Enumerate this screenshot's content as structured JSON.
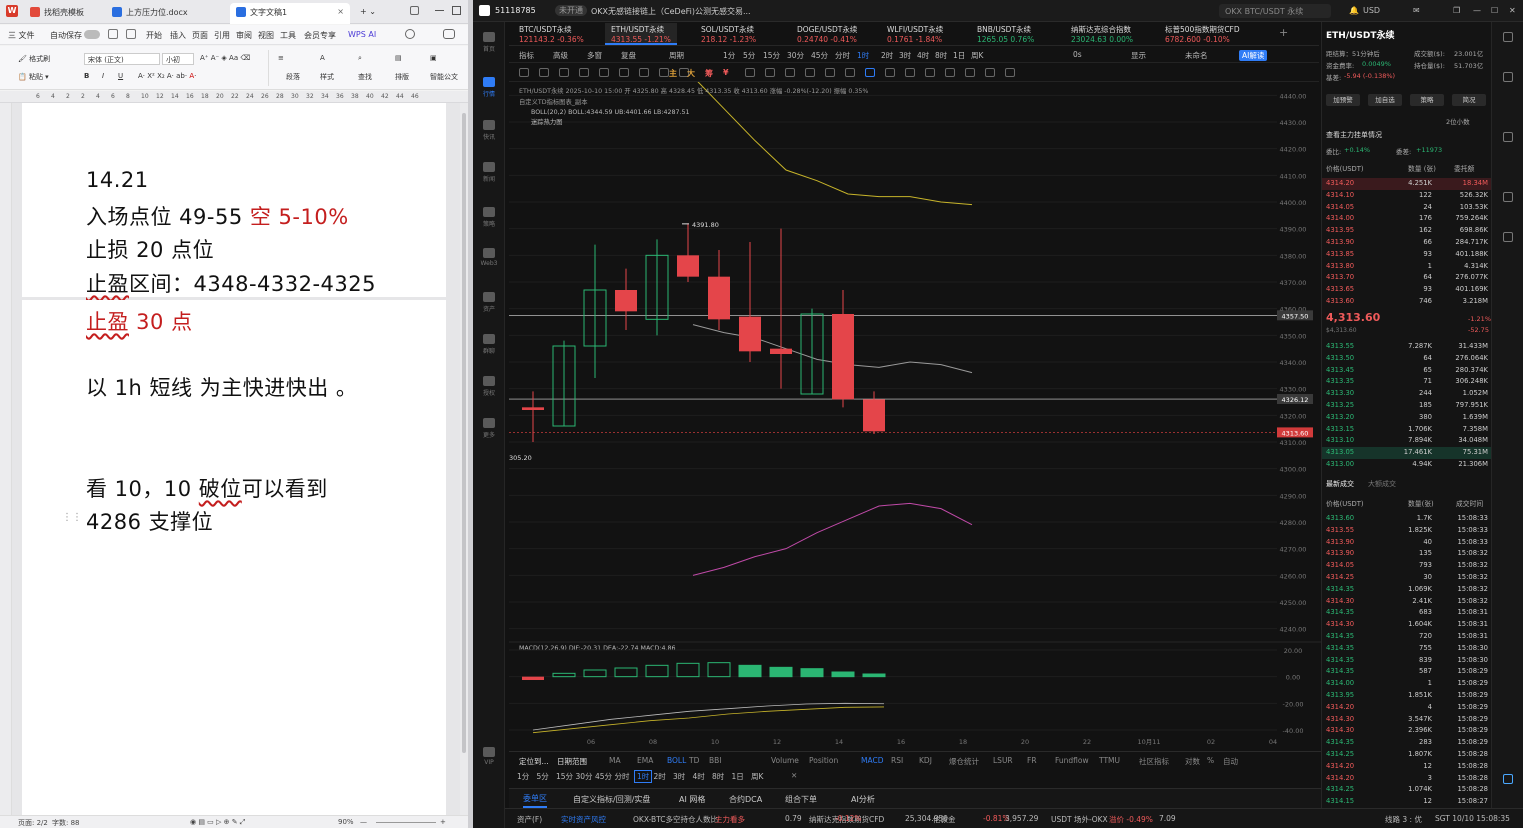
{
  "wps": {
    "tabs": [
      "找稻壳模板",
      "上方压力位.docx",
      "文字文稿1"
    ],
    "menu": [
      "三 文件",
      "自动保存",
      "开始",
      "插入",
      "页面",
      "引用",
      "审阅",
      "视图",
      "工具",
      "会员专享",
      "WPS AI"
    ],
    "tool": {
      "format_painter": "格式刷",
      "paste": "粘贴",
      "font": "宋体 (正文)",
      "size": "小初",
      "bold": "B",
      "italic": "I",
      "underline": "U",
      "paragraph": "段落",
      "style": "样式",
      "find": "查找",
      "layout": "排版",
      "smart": "智能公文"
    },
    "ruler": [
      "6",
      "4",
      "2",
      "2",
      "4",
      "6",
      "8",
      "10",
      "12",
      "14",
      "16",
      "18",
      "20",
      "22",
      "24",
      "26",
      "28",
      "30",
      "32",
      "34",
      "36",
      "38",
      "40",
      "42",
      "44",
      "46"
    ],
    "doc": {
      "l1": "14.21",
      "l2a": "入场点位 49-55 ",
      "l2b": "空  5-10%",
      "l3": "止损 20 点位",
      "l4a": "止盈",
      "l4b": "区间：4348-4332-4325",
      "l5a": "止盈",
      "l5b": " 30 点",
      "l6": "以 1h 短线  为主快进快出  。",
      "l7a": "看 10，10 ",
      "l7b": "破位",
      "l7c": "可以看到",
      "l8": "4286 支撑位"
    },
    "status": {
      "page": "页面: 2/2",
      "words": "字数: 88",
      "zoom": "90%"
    }
  },
  "okx": {
    "account": "51118785",
    "badge": "未开通",
    "notice": "OKX无感链接链上（CeDeFi)公测无感交易...",
    "search": "OKX BTC/USDT 永续",
    "currency": "USD",
    "tickers": [
      {
        "name": "BTC/USDT永续",
        "price": "121143.2",
        "chg": "-0.36%",
        "up": false
      },
      {
        "name": "ETH/USDT永续",
        "price": "4313.55",
        "chg": "-1.21%",
        "up": false
      },
      {
        "name": "SOL/USDT永续",
        "price": "218.12",
        "chg": "-1.23%",
        "up": false
      },
      {
        "name": "DOGE/USDT永续",
        "price": "0.24740",
        "chg": "-0.41%",
        "up": false
      },
      {
        "name": "WLFI/USDT永续",
        "price": "0.1761",
        "chg": "-1.84%",
        "up": false
      },
      {
        "name": "BNB/USDT永续",
        "price": "1265.05",
        "chg": "0.76%",
        "up": true
      },
      {
        "name": "纳斯达克综合指数",
        "price": "23024.63",
        "chg": "0.00%",
        "up": true
      },
      {
        "name": "标普500指数期货CFD",
        "price": "6782.600",
        "chg": "-0.10%",
        "up": false
      }
    ],
    "chart_tools": [
      "指标",
      "高级",
      "多窗",
      "复盘",
      "周期",
      "1分",
      "5分",
      "15分",
      "30分",
      "45分",
      "分时",
      "1时",
      "2时",
      "3时",
      "4时",
      "8时",
      "1日",
      "周K",
      "0s",
      "显示",
      "未命名",
      "AI解读"
    ],
    "draw_tools": [
      "主",
      "大",
      "筹",
      "¥"
    ],
    "legend": {
      "line1": "ETH/USDT永续 2025-10-10 15:00 开 4325.80 高 4328.45 低 4313.35 收 4313.60 涨幅 -0.28%(-12.20) 振幅 0.35%",
      "line2": "自定义TD指标图表_副本",
      "line3": "BOLL(20,2) BOLL:4344.59 UB:4401.66 LB:4287.51",
      "line4": "迷踪热力图",
      "macd": "MACD(12,26,9) DIF:-20.31 DEA:-22.74 MACD:4.86"
    },
    "high_label": "4391.80",
    "low_label": "305.20",
    "price_tags": [
      "4357.50",
      "4326.12",
      "4313.60"
    ],
    "y_ticks": [
      "4440.00",
      "4430.00",
      "4420.00",
      "4410.00",
      "4400.00",
      "4390.00",
      "4380.00",
      "4370.00",
      "4360.00",
      "4350.00",
      "4340.00",
      "4330.00",
      "4320.00",
      "4310.00",
      "4300.00",
      "4290.00",
      "4280.00",
      "4270.00",
      "4260.00",
      "4250.00",
      "4240.00"
    ],
    "macd_ticks": [
      "20.00",
      "0.00",
      "-20.00",
      "-40.00"
    ],
    "x_ticks": [
      "06",
      "08",
      "10",
      "12",
      "14",
      "16",
      "18",
      "20",
      "22",
      "10月11",
      "02",
      "04"
    ],
    "indicator_tabs": [
      "定位到...",
      "日期范围",
      "MA",
      "EMA",
      "BOLL",
      "TD",
      "BBI",
      "Volume",
      "Position",
      "MACD",
      "RSI",
      "KDJ",
      "爆仓统计",
      "LSUR",
      "FR",
      "Fundflow",
      "TTMU",
      "社区指标",
      "对数",
      "%",
      "自动"
    ],
    "bottom_tfs": [
      "1分",
      "5分",
      "15分",
      "30分",
      "45分",
      "分时",
      "1时",
      "2时",
      "3时",
      "4时",
      "8时",
      "1日",
      "周K"
    ],
    "bottom_panels": [
      "委单区",
      "自定义指标/回测/实盘",
      "AI 网格",
      "合约DCA",
      "组合下单",
      "AI分析"
    ],
    "status": [
      "资产(F)",
      "实时资产风控",
      "OKX-BTC多空持仓人数比",
      "主力看多",
      "0.79",
      "纳斯达克指数期货CFD",
      "-0.12%",
      "25,304.950",
      "伦敦金",
      "-0.81%",
      "3,957.29",
      "USDT 场外-OKX",
      "溢价 -0.49%",
      "7.09",
      "线路 3 : 优",
      "SGT 10/10 15:08:35"
    ],
    "sidebar": [
      "首页",
      "行情",
      "快讯",
      "新闻",
      "策略",
      "Web3",
      "资产",
      "群聊",
      "授权",
      "更多",
      "VIP"
    ],
    "book": {
      "title": "ETH/USDT永续",
      "next_fund": "距结算：51分钟后",
      "rate": "资金费率:",
      "rate_v": "0.0049%",
      "basis": "基差:",
      "basis_v": "-5.94 (-0.138%)",
      "vol_l": "成交额($):",
      "vol_v": "23.001亿",
      "oi_l": "持仓量($):",
      "oi_v": "51.703亿",
      "btns": [
        "加预警",
        "加自选",
        "策略",
        "简况"
      ],
      "decimals": "2位小数",
      "main_orders": "查看主力挂单情况",
      "ratio_l": "委比:",
      "ratio_v": "+0.14%",
      "diff_l": "委差:",
      "diff_v": "+11973",
      "hdr": [
        "价格(USDT)",
        "数量 (张)",
        "委托额"
      ],
      "asks": [
        [
          "4314.20",
          "4.251K",
          "18.34M"
        ],
        [
          "4314.10",
          "122",
          "526.32K"
        ],
        [
          "4314.05",
          "24",
          "103.53K"
        ],
        [
          "4314.00",
          "176",
          "759.264K"
        ],
        [
          "4313.95",
          "162",
          "698.86K"
        ],
        [
          "4313.90",
          "66",
          "284.717K"
        ],
        [
          "4313.85",
          "93",
          "401.188K"
        ],
        [
          "4313.80",
          "1",
          "4.314K"
        ],
        [
          "4313.70",
          "64",
          "276.077K"
        ],
        [
          "4313.65",
          "93",
          "401.169K"
        ],
        [
          "4313.60",
          "746",
          "3.218M"
        ]
      ],
      "last": "4,313.60",
      "last_sub": "$4,313.60",
      "last_chg": "-1.21%",
      "last_chg2": "-52.75",
      "bids": [
        [
          "4313.55",
          "7.287K",
          "31.433M"
        ],
        [
          "4313.50",
          "64",
          "276.064K"
        ],
        [
          "4313.45",
          "65",
          "280.374K"
        ],
        [
          "4313.35",
          "71",
          "306.248K"
        ],
        [
          "4313.30",
          "244",
          "1.052M"
        ],
        [
          "4313.25",
          "185",
          "797.951K"
        ],
        [
          "4313.20",
          "380",
          "1.639M"
        ],
        [
          "4313.15",
          "1.706K",
          "7.358M"
        ],
        [
          "4313.10",
          "7.894K",
          "34.048M"
        ],
        [
          "4313.05",
          "17.461K",
          "75.31M"
        ],
        [
          "4313.00",
          "4.94K",
          "21.306M"
        ]
      ],
      "trades_tab": "最新成交",
      "trades_tab2": "大额成交",
      "trades_hdr": [
        "价格(USDT)",
        "数量(张)",
        "成交时间"
      ],
      "trades": [
        [
          "4313.60",
          "1.7K",
          "15:08:33",
          "g"
        ],
        [
          "4313.55",
          "1.825K",
          "15:08:33",
          "r"
        ],
        [
          "4313.90",
          "40",
          "15:08:33",
          "r"
        ],
        [
          "4313.90",
          "135",
          "15:08:32",
          "r"
        ],
        [
          "4314.05",
          "793",
          "15:08:32",
          "r"
        ],
        [
          "4314.25",
          "30",
          "15:08:32",
          "r"
        ],
        [
          "4314.35",
          "1.069K",
          "15:08:32",
          "g"
        ],
        [
          "4314.30",
          "2.41K",
          "15:08:32",
          "r"
        ],
        [
          "4314.35",
          "683",
          "15:08:31",
          "g"
        ],
        [
          "4314.30",
          "1.604K",
          "15:08:31",
          "r"
        ],
        [
          "4314.35",
          "720",
          "15:08:31",
          "g"
        ],
        [
          "4314.35",
          "755",
          "15:08:30",
          "g"
        ],
        [
          "4314.35",
          "839",
          "15:08:30",
          "g"
        ],
        [
          "4314.35",
          "587",
          "15:08:29",
          "g"
        ],
        [
          "4314.00",
          "1",
          "15:08:29",
          "g"
        ],
        [
          "4313.95",
          "1.851K",
          "15:08:29",
          "g"
        ],
        [
          "4314.20",
          "4",
          "15:08:29",
          "r"
        ],
        [
          "4314.30",
          "3.547K",
          "15:08:29",
          "r"
        ],
        [
          "4314.30",
          "2.396K",
          "15:08:29",
          "r"
        ],
        [
          "4314.35",
          "283",
          "15:08:29",
          "g"
        ],
        [
          "4314.25",
          "1.807K",
          "15:08:28",
          "g"
        ],
        [
          "4314.20",
          "12",
          "15:08:28",
          "r"
        ],
        [
          "4314.20",
          "3",
          "15:08:28",
          "r"
        ],
        [
          "4314.25",
          "1.074K",
          "15:08:28",
          "g"
        ],
        [
          "4314.15",
          "12",
          "15:08:27",
          "g"
        ]
      ]
    }
  },
  "chart_data": {
    "type": "candlestick",
    "interval": "1h",
    "title": "ETH/USDT永续",
    "ylim": [
      4235,
      4445
    ],
    "candles": [
      {
        "o": 4323,
        "h": 4329,
        "l": 4310,
        "c": 4322
      },
      {
        "o": 4316,
        "h": 4348,
        "l": 4316,
        "c": 4346
      },
      {
        "o": 4346,
        "h": 4384,
        "l": 4334,
        "c": 4367
      },
      {
        "o": 4367,
        "h": 4375,
        "l": 4352,
        "c": 4359
      },
      {
        "o": 4356,
        "h": 4386,
        "l": 4350,
        "c": 4380
      },
      {
        "o": 4380,
        "h": 4392,
        "l": 4370,
        "c": 4372
      },
      {
        "o": 4372,
        "h": 4382,
        "l": 4352,
        "c": 4356
      },
      {
        "o": 4357,
        "h": 4385,
        "l": 4340,
        "c": 4344
      },
      {
        "o": 4345,
        "h": 4390,
        "l": 4330,
        "c": 4343
      },
      {
        "o": 4328,
        "h": 4360,
        "l": 4328,
        "c": 4358
      },
      {
        "o": 4358,
        "h": 4367,
        "l": 4323,
        "c": 4326
      },
      {
        "o": 4326,
        "h": 4329,
        "l": 4313,
        "c": 4314
      }
    ],
    "boll_upper": [
      4447,
      4435,
      4423,
      4412,
      4408,
      4403,
      4402,
      4402,
      4400,
      4399
    ],
    "boll_mid": [
      4354,
      4351,
      4349,
      4345,
      4341,
      4339,
      4338,
      4340,
      4339,
      4336
    ],
    "boll_lower": [
      4260,
      4263,
      4267,
      4270,
      4276,
      4281,
      4286,
      4287,
      4285,
      4279
    ],
    "macd": {
      "hist": [
        -2.5,
        2.5,
        5,
        6.5,
        8.5,
        10,
        10.5,
        8.5,
        7,
        6,
        3.5,
        2
      ],
      "dif": [
        -40,
        -36,
        -32,
        -29,
        -26,
        -24,
        -22,
        -20.5,
        -20,
        -20.3
      ],
      "dea": [
        -42,
        -39,
        -36,
        -33,
        -31,
        -28,
        -26,
        -24.5,
        -23,
        -22.7
      ],
      "ylim": [
        -40,
        20
      ]
    }
  }
}
